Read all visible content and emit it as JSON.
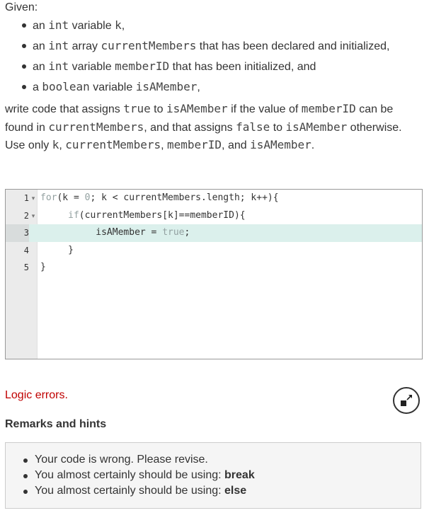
{
  "problem": {
    "given": "Given:",
    "bullets": [
      {
        "pre": "an ",
        "code": "int",
        "post": " variable ",
        "code2": "k",
        "post2": ","
      },
      {
        "pre": "an ",
        "code": "int",
        "post": " array ",
        "code2": "currentMembers",
        "post2": " that has been declared and initialized,"
      },
      {
        "pre": "an ",
        "code": "int",
        "post": " variable ",
        "code2": "memberID",
        "post2": " that has been initialized, and"
      },
      {
        "pre": "a ",
        "code": "boolean",
        "post": "  variable ",
        "code2": "isAMember",
        "post2": ","
      }
    ],
    "para1": [
      {
        "t": "write code that assigns "
      },
      {
        "c": "true"
      },
      {
        "t": " to "
      },
      {
        "c": "isAMember"
      },
      {
        "t": " if the value of "
      },
      {
        "c": "memberID"
      },
      {
        "t": " can be found in "
      },
      {
        "c": "currentMembers"
      },
      {
        "t": ", and that assigns "
      },
      {
        "c": "false"
      },
      {
        "t": " to "
      },
      {
        "c": "isAMember"
      },
      {
        "t": " otherwise."
      }
    ],
    "para2": [
      {
        "t": "Use only "
      },
      {
        "c": "k"
      },
      {
        "t": ", "
      },
      {
        "c": "currentMembers"
      },
      {
        "t": ", "
      },
      {
        "c": "memberID"
      },
      {
        "t": ", and "
      },
      {
        "c": "isAMember"
      },
      {
        "t": "."
      }
    ]
  },
  "editor": {
    "lines": [
      {
        "num": "1",
        "fold": "▾",
        "indent": "",
        "parts": [
          {
            "k": "for"
          },
          {
            "t": "(k = "
          },
          {
            "n": "0"
          },
          {
            "t": "; k < currentMembers.length; k++){"
          }
        ]
      },
      {
        "num": "2",
        "fold": "▾",
        "indent": "     ",
        "parts": [
          {
            "k": "if"
          },
          {
            "t": "(currentMembers[k]==memberID){"
          }
        ]
      },
      {
        "num": "3",
        "fold": "",
        "indent": "          ",
        "active": true,
        "parts": [
          {
            "t": "isAMember = "
          },
          {
            "b": "true"
          },
          {
            "t": ";"
          }
        ]
      },
      {
        "num": "4",
        "fold": "",
        "indent": "     ",
        "parts": [
          {
            "t": "}"
          }
        ]
      },
      {
        "num": "5",
        "fold": "",
        "indent": "",
        "parts": [
          {
            "t": "}"
          }
        ]
      }
    ]
  },
  "result": {
    "error_text": "Logic errors.",
    "remarks_title": "Remarks and hints",
    "hints": [
      {
        "text": "Your code is wrong. Please revise.",
        "bold": ""
      },
      {
        "text": "You almost certainly should be using: ",
        "bold": "break"
      },
      {
        "text": "You almost certainly should be using: ",
        "bold": "else"
      }
    ]
  },
  "colors": {
    "error": "#c00000",
    "active_line": "#dbf0ec",
    "keyword": "#93a1a1"
  },
  "icons": {
    "expand": "expand-arrows-icon"
  }
}
